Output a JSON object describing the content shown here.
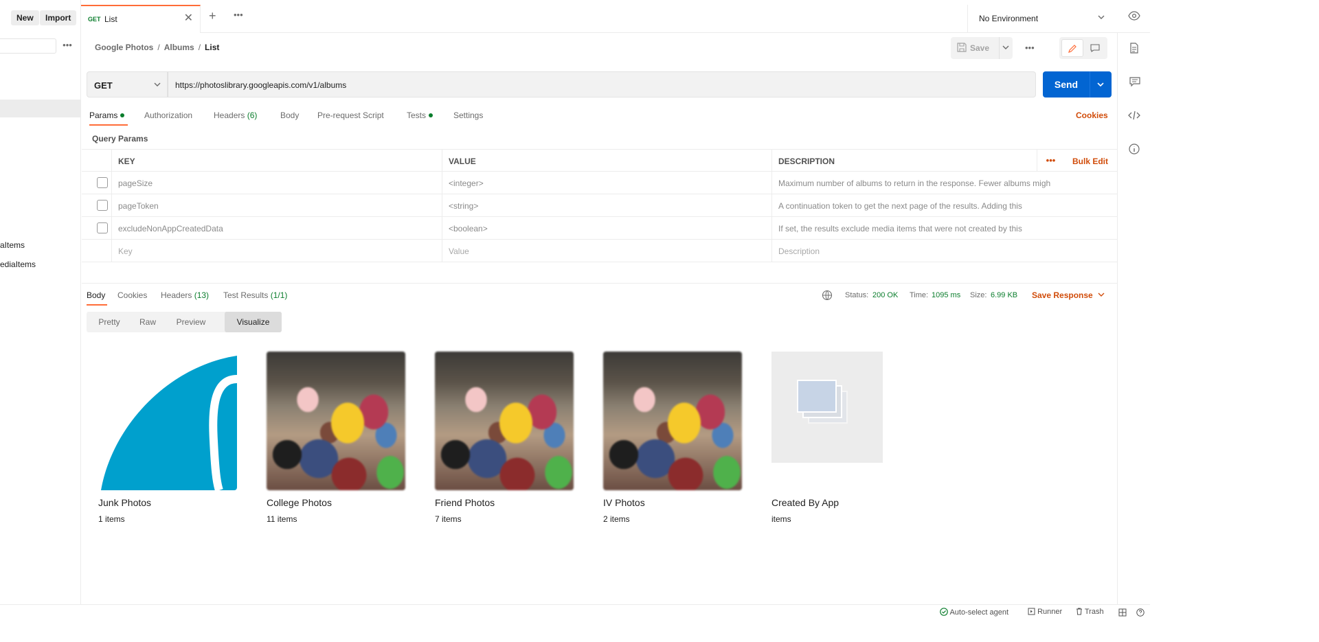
{
  "sidebar": {
    "new_label": "New",
    "import_label": "Import",
    "truncated_items": [
      "aItems",
      "ediaItems"
    ]
  },
  "tab_bar": {
    "tab_method": "GET",
    "tab_title": "List",
    "environment": "No Environment"
  },
  "breadcrumb": {
    "items": [
      "Google Photos",
      "Albums"
    ],
    "current": "List"
  },
  "toolbar": {
    "save_label": "Save"
  },
  "request": {
    "method": "GET",
    "url": "https://photoslibrary.googleapis.com/v1/albums",
    "send_label": "Send"
  },
  "request_tabs": {
    "params": "Params",
    "authorization": "Authorization",
    "headers": "Headers",
    "headers_count": "(6)",
    "body": "Body",
    "pre_request": "Pre-request Script",
    "tests": "Tests",
    "settings": "Settings",
    "cookies": "Cookies"
  },
  "query_params": {
    "title": "Query Params",
    "columns": {
      "key": "KEY",
      "value": "VALUE",
      "description": "DESCRIPTION"
    },
    "bulk_edit": "Bulk Edit",
    "rows": [
      {
        "key": "pageSize",
        "value": "<integer>",
        "description": "Maximum number of albums to return in the response. Fewer albums migh"
      },
      {
        "key": "pageToken",
        "value": "<string>",
        "description": "A continuation token to get the next page of the results. Adding this"
      },
      {
        "key": "excludeNonAppCreatedData",
        "value": "<boolean>",
        "description": "If set, the results exclude media items that were not created by this"
      }
    ],
    "placeholder": {
      "key": "Key",
      "value": "Value",
      "description": "Description"
    }
  },
  "response": {
    "tabs": {
      "body": "Body",
      "cookies": "Cookies",
      "headers": "Headers",
      "headers_count": "(13)",
      "test_results": "Test Results",
      "test_results_count": "(1/1)"
    },
    "status_label": "Status:",
    "status": "200 OK",
    "time_label": "Time:",
    "time": "1095 ms",
    "size_label": "Size:",
    "size": "6.99 KB",
    "save_response": "Save Response",
    "view_tabs": [
      "Pretty",
      "Raw",
      "Preview",
      "Visualize"
    ],
    "active_view": "Visualize"
  },
  "albums": [
    {
      "title": "Junk Photos",
      "count": "1 items",
      "thumb": "blue-logo"
    },
    {
      "title": "College Photos",
      "count": "11 items",
      "thumb": "group-photo"
    },
    {
      "title": "Friend Photos",
      "count": "7 items",
      "thumb": "group-photo"
    },
    {
      "title": "IV Photos",
      "count": "2 items",
      "thumb": "group-photo"
    },
    {
      "title": "Created By App",
      "count": "items",
      "thumb": "placeholder"
    }
  ],
  "status_bar": {
    "agent": "Auto-select agent",
    "runner": "Runner",
    "trash": "Trash"
  },
  "colors": {
    "accent": "#ff6c37",
    "send": "#0265d2",
    "success": "#0a7d2c",
    "link": "#d14c0a"
  }
}
